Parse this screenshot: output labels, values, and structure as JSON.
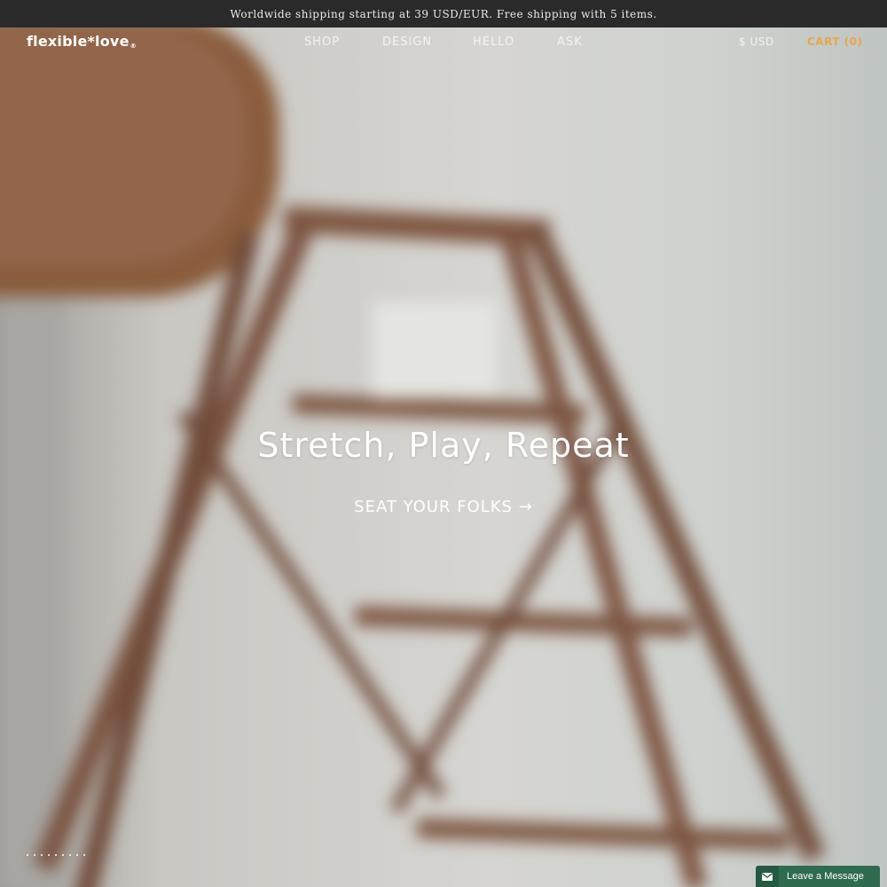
{
  "announcement": "Worldwide shipping starting at 39 USD/EUR. Free shipping with 5 items.",
  "brand": {
    "logo_text": "flexible*love",
    "logo_mark": "®"
  },
  "nav": {
    "items": [
      "SHOP",
      "DESIGN",
      "HELLO",
      "ASK"
    ]
  },
  "header": {
    "currency": "$ USD",
    "cart": "CART (0)"
  },
  "hero": {
    "headline": "Stretch, Play, Repeat",
    "cta": "SEAT YOUR FOLKS →",
    "slide_count": 9
  },
  "chat": {
    "label": "Leave a Message",
    "icon": "envelope-icon"
  },
  "colors": {
    "top_bar": "#2a2a2a",
    "cart_accent": "#e6a64a",
    "chat_bg": "#2f6b4f"
  }
}
